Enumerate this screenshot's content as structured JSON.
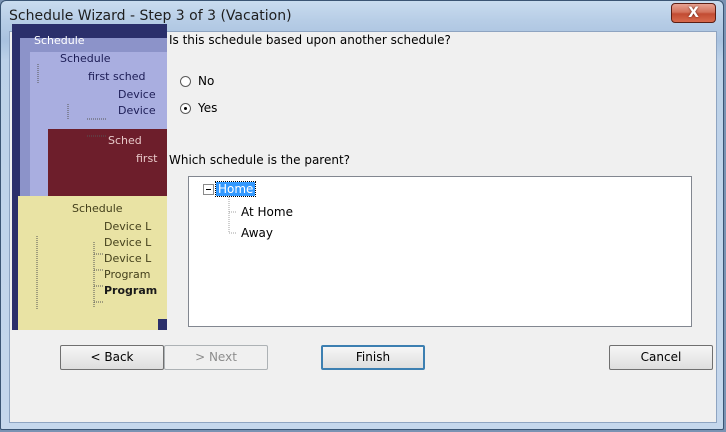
{
  "window": {
    "title": "Schedule Wizard - Step 3 of 3 (Vacation)",
    "close_label": "X"
  },
  "side_image": {
    "nodes": [
      "Schedule",
      "Schedule",
      "first sched",
      "Device",
      "Device",
      "Sched",
      "first",
      "Schedule",
      "Device L",
      "Device L",
      "Device L",
      "Program",
      "Program"
    ]
  },
  "question": "Is this schedule based upon another schedule?",
  "radios": [
    {
      "label": "No",
      "checked": false
    },
    {
      "label": "Yes",
      "checked": true
    }
  ],
  "parent_question": "Which schedule is the parent?",
  "tree": {
    "root": {
      "label": "Home",
      "expander": "⊟",
      "selected": true
    },
    "children": [
      "At Home",
      "Away"
    ]
  },
  "buttons": {
    "back": "< Back",
    "next": "> Next",
    "finish": "Finish",
    "cancel": "Cancel"
  }
}
